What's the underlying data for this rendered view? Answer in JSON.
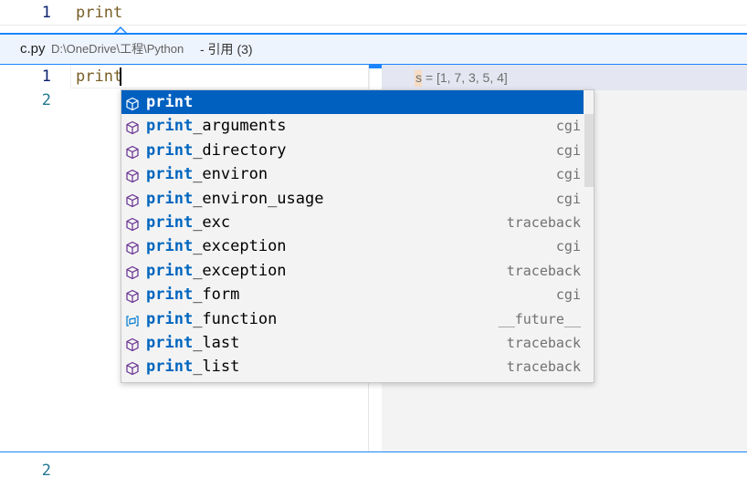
{
  "editor_top": {
    "line_number": "1",
    "code": "print"
  },
  "peek": {
    "file_name": "c.py",
    "file_path": "D:\\OneDrive\\工程\\Python",
    "references_label": "- 引用 (3)",
    "lines": [
      {
        "number": "1",
        "code": "print"
      },
      {
        "number": "2",
        "code": ""
      }
    ],
    "reference_preview": {
      "highlight": "s",
      "rest": " = [1, 7, 3, 5, 4]"
    }
  },
  "suggest": {
    "match": "print",
    "items": [
      {
        "suffix": "",
        "detail": "",
        "icon": "module-icon",
        "selected": true
      },
      {
        "suffix": "_arguments",
        "detail": "cgi",
        "icon": "module-icon"
      },
      {
        "suffix": "_directory",
        "detail": "cgi",
        "icon": "module-icon"
      },
      {
        "suffix": "_environ",
        "detail": "cgi",
        "icon": "module-icon"
      },
      {
        "suffix": "_environ_usage",
        "detail": "cgi",
        "icon": "module-icon"
      },
      {
        "suffix": "_exc",
        "detail": "traceback",
        "icon": "module-icon"
      },
      {
        "suffix": "_exception",
        "detail": "cgi",
        "icon": "module-icon"
      },
      {
        "suffix": "_exception",
        "detail": "traceback",
        "icon": "module-icon"
      },
      {
        "suffix": "_form",
        "detail": "cgi",
        "icon": "module-icon"
      },
      {
        "suffix": "_function",
        "detail": "__future__",
        "icon": "variable-icon"
      },
      {
        "suffix": "_last",
        "detail": "traceback",
        "icon": "module-icon"
      },
      {
        "suffix": "_list",
        "detail": "traceback",
        "icon": "module-icon"
      }
    ]
  },
  "editor_bottom": {
    "line_number": "2"
  },
  "colors": {
    "accent": "#1a85ff",
    "selection": "#0060c0",
    "match": "#0066bf",
    "module_icon": "#652d90",
    "variable_icon": "#007acc"
  }
}
